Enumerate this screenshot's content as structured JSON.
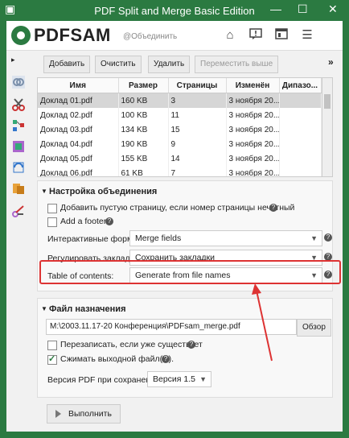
{
  "window": {
    "title": "PDF Split and Merge Basic Edition"
  },
  "header": {
    "logo": "PDFSAM",
    "subtitle": "@Объединить"
  },
  "toolbar": {
    "add": "Добавить",
    "clear": "Очистить",
    "remove": "Удалить",
    "move_up": "Переместить выше",
    "more": "»"
  },
  "table": {
    "columns": [
      "Имя",
      "Размер",
      "Страницы",
      "Изменён",
      "Дипазо..."
    ],
    "rows": [
      [
        "Доклад 01.pdf",
        "160 KB",
        "3",
        "3 ноября 20...",
        ""
      ],
      [
        "Доклад 02.pdf",
        "100 KB",
        "11",
        "3 ноября 20...",
        ""
      ],
      [
        "Доклад 03.pdf",
        "134 KB",
        "15",
        "3 ноября 20...",
        ""
      ],
      [
        "Доклад 04.pdf",
        "190 KB",
        "9",
        "3 ноября 20...",
        ""
      ],
      [
        "Доклад 05.pdf",
        "155 KB",
        "14",
        "3 ноября 20...",
        ""
      ],
      [
        "Доклад 06.pdf",
        "61 KB",
        "7",
        "3 ноября 20...",
        ""
      ]
    ],
    "selected_row": 0
  },
  "merge_settings": {
    "title": "Настройка объединения",
    "blank_page_label": "Добавить пустую страницу, если номер страницы нечетный",
    "footer_label": "Add a footer",
    "forms_label": "Интерактивные форм...",
    "forms_value": "Merge fields",
    "bookmarks_label": "Регулировать закладки:",
    "bookmarks_value": "Сохранить закладки",
    "toc_label": "Table of contents:",
    "toc_value": "Generate from file names"
  },
  "destination": {
    "title": "Файл назначения",
    "path": "M:\\2003.11.17-20 Конференция\\PDFsam_merge.pdf",
    "browse": "Обзор",
    "overwrite_label": "Перезаписать, если уже существует",
    "compress_label": "Сжимать выходной файл(ы).",
    "version_label": "Версия PDF при сохранении:",
    "version_value": "Версия 1.5"
  },
  "run": {
    "label": "Выполнить"
  },
  "colors": {
    "accent": "#2b7a41",
    "highlight": "#d33333"
  }
}
